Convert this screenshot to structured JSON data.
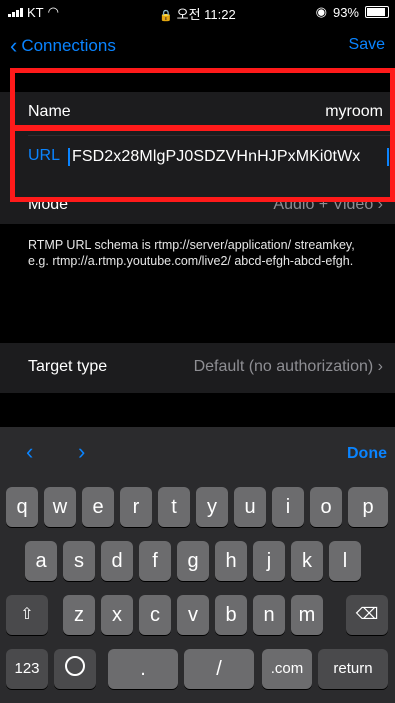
{
  "status": {
    "carrier": "KT",
    "time": "오전 11:22",
    "battery": "93%"
  },
  "nav": {
    "back_label": "Connections",
    "save_label": "Save"
  },
  "rows": {
    "name_label": "Name",
    "name_value": "myroom",
    "url_label": "URL",
    "url_value": "FSD2x28MlgPJ0SDZVHnHJPxMKi0tWx",
    "mode_label": "Mode",
    "mode_value": "Audio + Video",
    "target_label": "Target type",
    "target_value": "Default (no authorization)"
  },
  "footer_text": "RTMP URL schema is rtmp://server/application/ streamkey, e.g. rtmp://a.rtmp.youtube.com/live2/ abcd-efgh-abcd-efgh.",
  "keyboard": {
    "done_label": "Done",
    "row1": [
      "q",
      "w",
      "e",
      "r",
      "t",
      "y",
      "u",
      "i",
      "o",
      "p"
    ],
    "row2": [
      "a",
      "s",
      "d",
      "f",
      "g",
      "h",
      "j",
      "k",
      "l"
    ],
    "row3": [
      "z",
      "x",
      "c",
      "v",
      "b",
      "n",
      "m"
    ],
    "numbers_label": "123",
    "dot_label": ".",
    "slash_label": "/",
    "com_label": ".com",
    "return_label": "return"
  },
  "colors": {
    "accent": "#0a84ff",
    "highlight": "#ff1a1a",
    "cell": "#1c1c1e"
  }
}
